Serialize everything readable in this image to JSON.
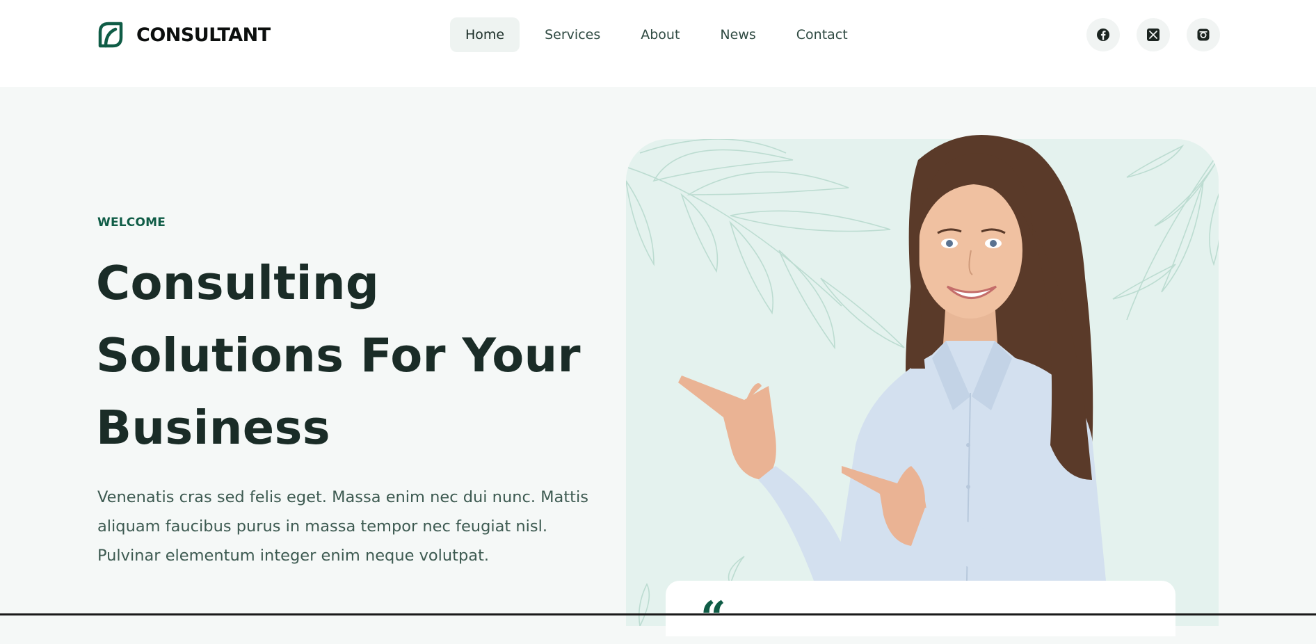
{
  "brand": {
    "name": "CONSULTANT",
    "accent_color": "#0f5c46",
    "logo_icon": "leaf-logo-icon"
  },
  "nav": {
    "items": [
      {
        "label": "Home",
        "active": true
      },
      {
        "label": "Services",
        "active": false
      },
      {
        "label": "About",
        "active": false
      },
      {
        "label": "News",
        "active": false
      },
      {
        "label": "Contact",
        "active": false
      }
    ]
  },
  "socials": [
    {
      "icon": "facebook-icon"
    },
    {
      "icon": "x-twitter-icon"
    },
    {
      "icon": "instagram-icon"
    }
  ],
  "hero": {
    "eyebrow": "WELCOME",
    "title_lines": [
      "Consulting",
      "Solutions For Your",
      "Business"
    ],
    "description_lines": [
      "Venenatis cras sed felis eget. Massa enim nec dui nunc. Mattis",
      "aliquam faucibus purus in massa tempor nec feugiat nisl.",
      "Pulvinar elementum integer enim neque volutpat."
    ],
    "background_color": "#e4f2ee",
    "quote_mark": "“"
  }
}
